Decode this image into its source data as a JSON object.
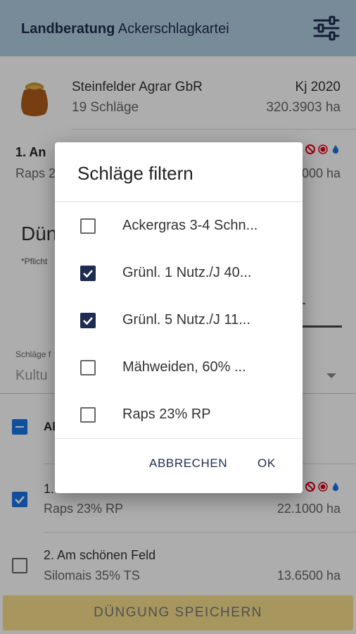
{
  "appbar": {
    "title_bold": "Landberatung",
    "title_rest": "Ackerschlagkartei",
    "menu_icon": "sliders-icon"
  },
  "farm": {
    "name": "Steinfelder Agrar GbR",
    "field_count": "19 Schläge",
    "year": "Kj 2020",
    "area": "320.3903 ha",
    "icon": "grain-sack-icon"
  },
  "first_field": {
    "name": "1. An",
    "crop": "Raps 2",
    "area": "000 ha"
  },
  "section": {
    "title": "Dün",
    "note": "*Pflicht"
  },
  "filter": {
    "label": "Schläge f",
    "value": "Kultu"
  },
  "list": {
    "select_all_label": "Al",
    "rows": [
      {
        "name": "1.",
        "crop": "Raps 23% RP",
        "area": "22.1000 ha",
        "checked": true
      },
      {
        "name": "2. Am schönen Feld",
        "crop": "Silomais 35% TS",
        "area": "13.6500 ha",
        "checked": false
      }
    ]
  },
  "save_button": "DÜNGUNG SPEICHERN",
  "dialog": {
    "title": "Schläge filtern",
    "options": [
      {
        "label": "Ackergras 3-4 Schn...",
        "checked": false
      },
      {
        "label": "Grünl. 1 Nutz./J 40...",
        "checked": true
      },
      {
        "label": "Grünl. 5 Nutz./J 11...",
        "checked": true
      },
      {
        "label": "Mähweiden, 60% ...",
        "checked": false
      },
      {
        "label": "Raps 23% RP",
        "checked": false
      }
    ],
    "cancel": "ABBRECHEN",
    "ok": "OK"
  },
  "colors": {
    "appbar": "#b2cde0",
    "primary_dark": "#1d2c50",
    "checkbox_blue": "#1a73e8",
    "save_button_bg": "#f6df8c",
    "status_red": "#e0001b",
    "status_blue": "#1a73e8"
  }
}
